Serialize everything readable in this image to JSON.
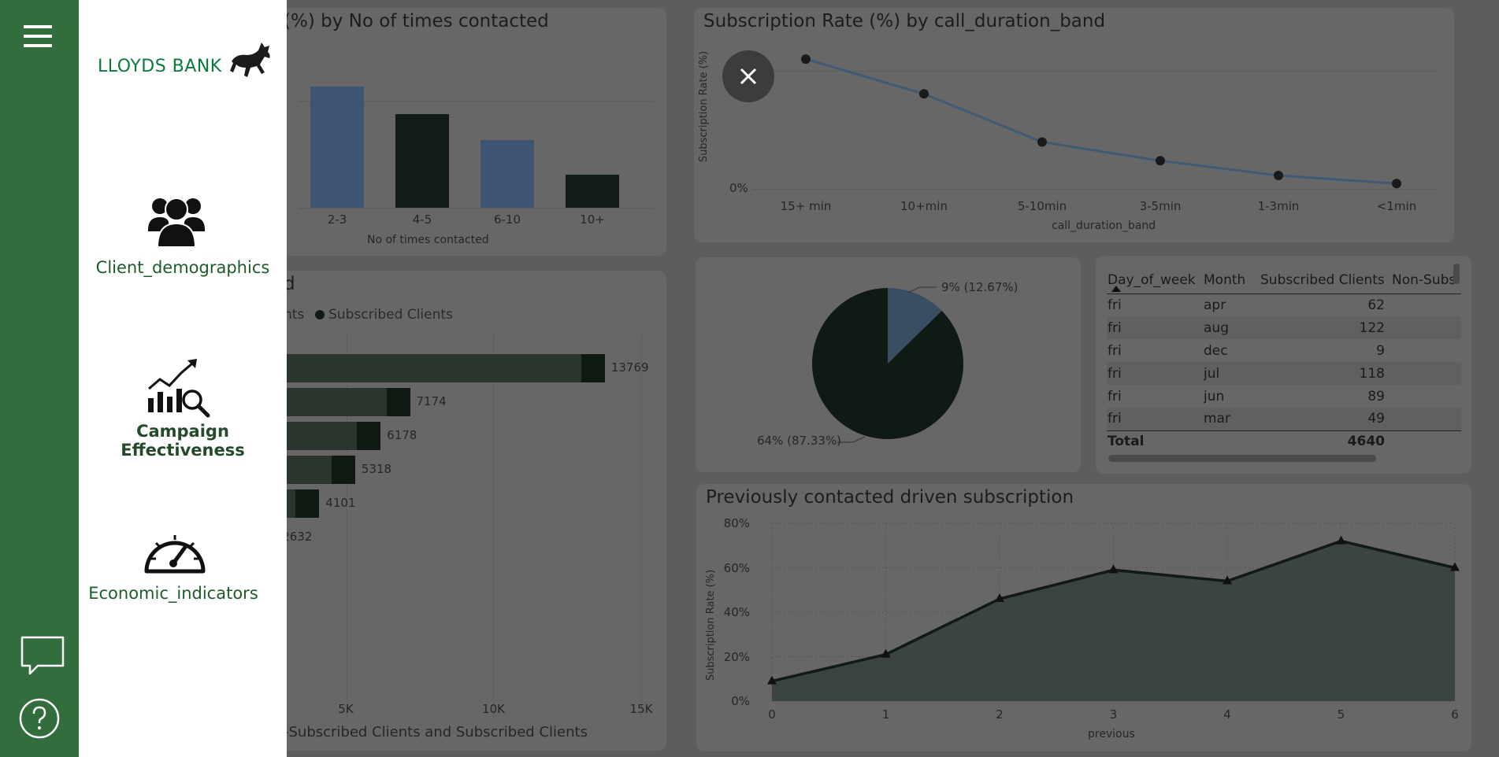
{
  "nav": {
    "brand": "LLOYDS BANK",
    "items": [
      {
        "label": "Client_demographics",
        "icon": "people-group-icon"
      },
      {
        "label": "Campaign Effectiveness",
        "icon": "growth-chart-magnifier-icon"
      },
      {
        "label": "Economic_indicators",
        "icon": "speedometer-icon"
      }
    ],
    "colors": {
      "rail": "#336d3c",
      "text": "#1e5a2c",
      "accent": "#0a7a3c"
    }
  },
  "charts": {
    "contacts": {
      "title": "(%) by No of times contacted",
      "xlabel": "No of times contacted"
    },
    "duration": {
      "title": "Subscription Rate (%) by call_duration_band",
      "xlabel": "call_duration_band",
      "ylabel": "Subscription Rate (%)",
      "y0": "0%"
    },
    "funnel": {
      "title": "d",
      "legend_partial": "nts",
      "legend_series": "Subscribed Clients",
      "xlabel": "-Subscribed Clients and Subscribed Clients"
    },
    "pie": {
      "label_small": "9% (12.67%)",
      "label_large": "64% (87.33%)"
    },
    "table": {
      "headers": [
        "Day_of_week",
        "Month",
        "Subscribed Clients",
        "Non-Subs"
      ],
      "rows": [
        [
          "fri",
          "apr",
          "62"
        ],
        [
          "fri",
          "aug",
          "122"
        ],
        [
          "fri",
          "dec",
          "9"
        ],
        [
          "fri",
          "jul",
          "118"
        ],
        [
          "fri",
          "jun",
          "89"
        ],
        [
          "fri",
          "mar",
          "49"
        ]
      ],
      "total_label": "Total",
      "total_value": "4640"
    },
    "previous": {
      "title": "Previously contacted driven subscription",
      "xlabel": "previous",
      "ylabel": "Subscription Rate (%)"
    }
  },
  "chart_data": [
    {
      "type": "bar",
      "categories": [
        "2-3",
        "4-5",
        "6-10",
        "10+"
      ],
      "values": [
        100,
        77,
        56,
        27
      ],
      "xlabel": "No of times contacted"
    },
    {
      "type": "line",
      "categories": [
        "15+ min",
        "10+min",
        "5-10min",
        "3-5min",
        "1-3min",
        "<1min"
      ],
      "values": [
        0.485,
        0.355,
        0.175,
        0.105,
        0.05,
        0.02
      ],
      "ylim": [
        0,
        0.5
      ],
      "yticks": [
        "0%"
      ],
      "xlabel": "call_duration_band",
      "ylabel": "Subscription Rate (%)"
    },
    {
      "type": "bar",
      "orientation": "horizontal",
      "values": [
        13769,
        7174,
        6178,
        5318,
        4101,
        2632
      ],
      "xticks": [
        "5K",
        "10K",
        "15K"
      ],
      "xlim": [
        0,
        15000
      ]
    },
    {
      "type": "pie",
      "labels": [
        "9% (12.67%)",
        "64% (87.33%)"
      ],
      "values": [
        12.67,
        87.33
      ],
      "colors": [
        "#3a4e63",
        "#0f1a14"
      ]
    },
    {
      "type": "area",
      "x": [
        0,
        1,
        2,
        3,
        4,
        5,
        6
      ],
      "values": [
        9,
        21,
        46,
        59,
        54,
        72,
        60
      ],
      "ylim": [
        0,
        80
      ],
      "yticks": [
        "0%",
        "20%",
        "40%",
        "60%",
        "80%"
      ],
      "xlabel": "previous",
      "ylabel": "Subscription Rate (%)"
    }
  ]
}
